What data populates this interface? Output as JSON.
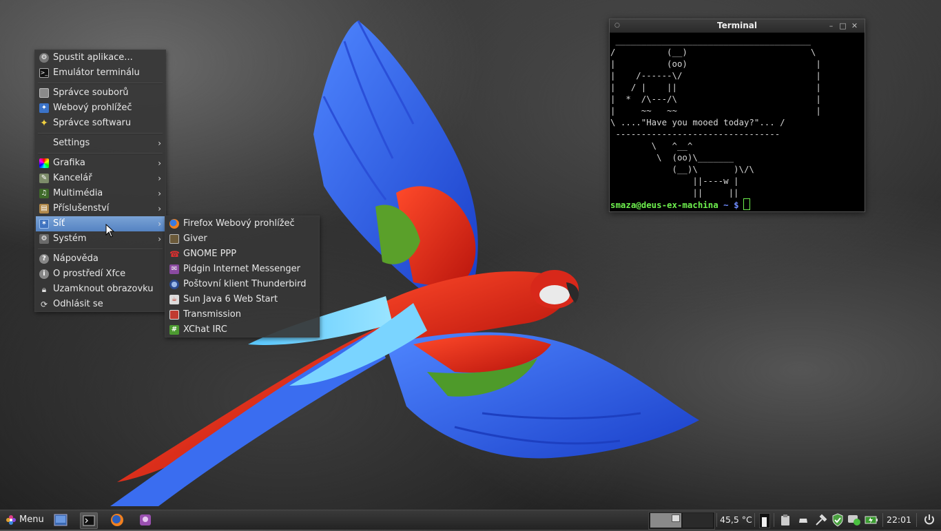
{
  "terminal": {
    "title": "Terminal",
    "cowsay": " ______________________________________\n/          (__)                        \\\n|          (oo)                         |\n|    /------\\/                          |\n|   / |    ||                           |\n|  *  /\\---/\\                           |\n|     ~~   ~~                           |\n\\ ....\"Have you mooed today?\"... /\n --------------------------------\n        \\   ^__^\n         \\  (oo)\\_______\n            (__)\\       )\\/\\\n                ||----w |\n                ||     ||",
    "prompt_user": "smaza@deus-ex-machina",
    "prompt_path": "~",
    "prompt_symbol": "$"
  },
  "main_menu": {
    "items": [
      {
        "label": "Spustit aplikace...",
        "icon": "gear-icon"
      },
      {
        "label": "Emulátor terminálu",
        "icon": "terminal-icon"
      },
      {
        "label": "Správce souborů",
        "icon": "file-manager-icon"
      },
      {
        "label": "Webový prohlížeč",
        "icon": "web-browser-icon"
      },
      {
        "label": "Správce softwaru",
        "icon": "software-manager-icon"
      },
      {
        "label": "Settings",
        "icon": ""
      },
      {
        "label": "Grafika",
        "icon": "graphics-icon"
      },
      {
        "label": "Kancelář",
        "icon": "office-icon"
      },
      {
        "label": "Multimédia",
        "icon": "multimedia-icon"
      },
      {
        "label": "Příslušenství",
        "icon": "accessories-icon"
      },
      {
        "label": "Síť",
        "icon": "network-icon"
      },
      {
        "label": "Systém",
        "icon": "system-icon"
      },
      {
        "label": "Nápověda",
        "icon": "help-icon"
      },
      {
        "label": "O prostředí Xfce",
        "icon": "info-icon"
      },
      {
        "label": "Uzamknout obrazovku",
        "icon": "lock-icon"
      },
      {
        "label": "Odhlásit se",
        "icon": "logout-icon"
      }
    ]
  },
  "sub_menu": {
    "items": [
      {
        "label": "Firefox Webový prohlížeč",
        "icon": "firefox-icon"
      },
      {
        "label": "Giver",
        "icon": "giver-icon"
      },
      {
        "label": "GNOME PPP",
        "icon": "phone-icon"
      },
      {
        "label": "Pidgin Internet Messenger",
        "icon": "pidgin-icon"
      },
      {
        "label": "Poštovní klient Thunderbird",
        "icon": "thunderbird-icon"
      },
      {
        "label": "Sun Java 6 Web Start",
        "icon": "java-icon"
      },
      {
        "label": "Transmission",
        "icon": "transmission-icon"
      },
      {
        "label": "XChat IRC",
        "icon": "xchat-icon"
      }
    ]
  },
  "taskbar": {
    "menu_label": "Menu",
    "temperature": "45,5 °C",
    "clock": "22:01"
  },
  "colors": {
    "menu_bg": "#373737",
    "menu_highlight": "#6a94cc",
    "prompt_green": "#6ef04e",
    "prompt_blue": "#6f8cff"
  }
}
